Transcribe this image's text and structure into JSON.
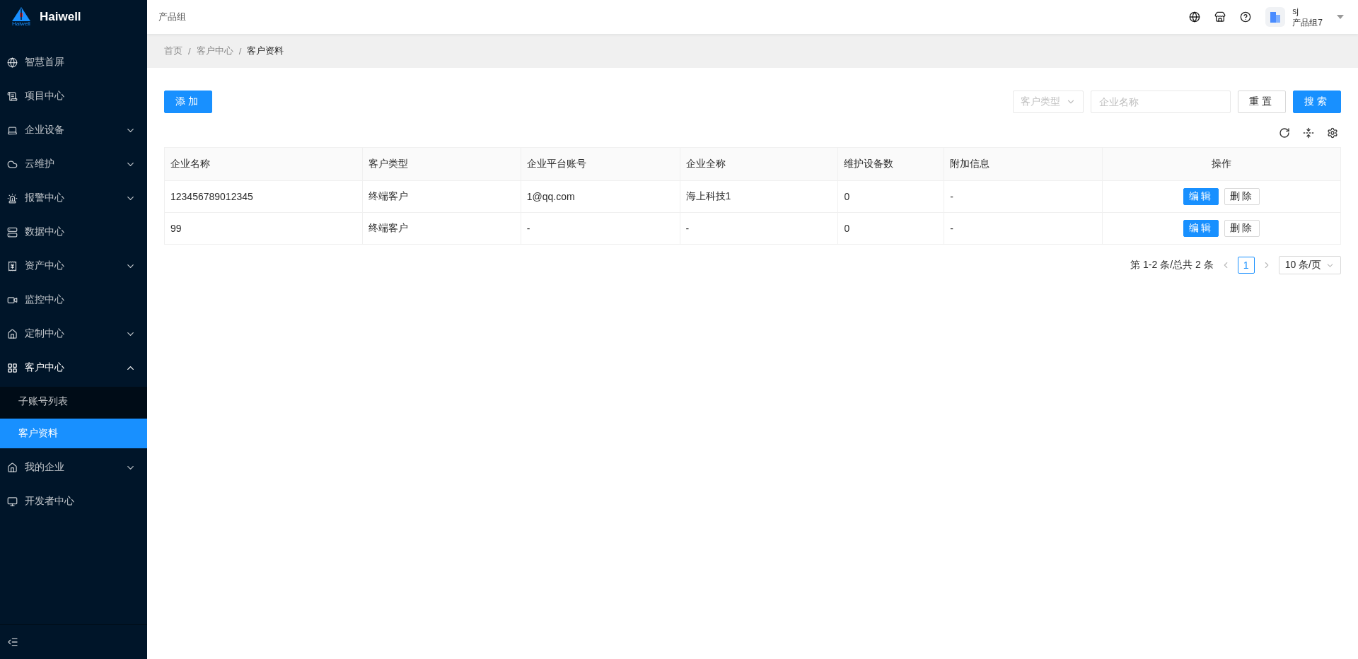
{
  "brand": {
    "logo_text": "Haiwell",
    "name": "Haiwell"
  },
  "header": {
    "group": "产品组",
    "user": {
      "name": "sj",
      "org": "产品组7"
    }
  },
  "sidebar": {
    "items": [
      {
        "label": "智慧首屏",
        "kind": "link",
        "selected": false
      },
      {
        "label": "项目中心",
        "kind": "link",
        "selected": false
      },
      {
        "label": "企业设备",
        "kind": "group",
        "expanded": false,
        "selected": false
      },
      {
        "label": "云维护",
        "kind": "group",
        "expanded": false,
        "selected": false
      },
      {
        "label": "报警中心",
        "kind": "group",
        "expanded": false,
        "selected": false
      },
      {
        "label": "数据中心",
        "kind": "link",
        "selected": false
      },
      {
        "label": "资产中心",
        "kind": "group",
        "expanded": false,
        "selected": false
      },
      {
        "label": "监控中心",
        "kind": "link",
        "selected": false
      },
      {
        "label": "定制中心",
        "kind": "group",
        "expanded": false,
        "selected": false
      },
      {
        "label": "客户中心",
        "kind": "group",
        "expanded": true,
        "selected": false,
        "children": [
          {
            "label": "子账号列表",
            "selected": false
          },
          {
            "label": "客户资料",
            "selected": true
          }
        ]
      },
      {
        "label": "我的企业",
        "kind": "group",
        "expanded": false,
        "selected": false
      },
      {
        "label": "开发者中心",
        "kind": "link",
        "selected": false
      }
    ]
  },
  "breadcrumb": {
    "items": [
      "首页",
      "客户中心",
      "客户资料"
    ],
    "separator": "/"
  },
  "toolbar": {
    "add_button": "添加",
    "type_select": {
      "placeholder": "客户类型"
    },
    "name_field": {
      "placeholder": "企业名称"
    },
    "reset_button": "重置",
    "search_button": "搜索"
  },
  "table": {
    "columns": [
      "企业名称",
      "客户类型",
      "企业平台账号",
      "企业全称",
      "维护设备数",
      "附加信息",
      "操作"
    ],
    "rows": [
      {
        "cells": [
          "123456789012345",
          "终端客户",
          "1@qq.com",
          "海上科技1",
          "0",
          "-"
        ],
        "actions": [
          "编辑",
          "删除"
        ]
      },
      {
        "cells": [
          "99",
          "终端客户",
          "-",
          "-",
          "0",
          "-"
        ],
        "actions": [
          "编辑",
          "删除"
        ]
      }
    ]
  },
  "pagination": {
    "summary": "第 1-2 条/总共 2 条",
    "pages": [
      {
        "label": "1",
        "selected": true
      }
    ],
    "page_size": "10 条/页"
  }
}
